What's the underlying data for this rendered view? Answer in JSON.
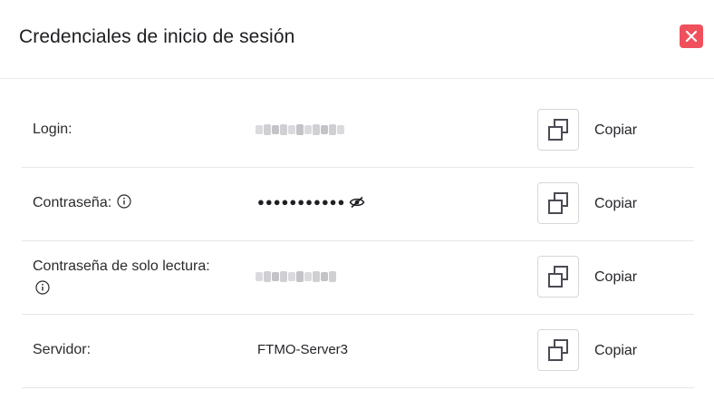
{
  "dialog": {
    "title": "Credenciales de inicio de sesión",
    "close_icon": "close-x-icon",
    "close_color": "#f0505c"
  },
  "rows": [
    {
      "label": "Login:",
      "value": "",
      "value_obscured": true,
      "copy_label": "Copiar",
      "copy_icon": "copy-icon"
    },
    {
      "label": "Contraseña:",
      "has_info": true,
      "value": "●●●●●●●●●●●",
      "toggle_icon": "eye-off-icon",
      "copy_label": "Copiar",
      "copy_icon": "copy-icon"
    },
    {
      "label": "Contraseña de solo lectura:",
      "has_info": true,
      "value": "",
      "value_obscured": true,
      "copy_label": "Copiar",
      "copy_icon": "copy-icon"
    },
    {
      "label": "Servidor:",
      "value": "FTMO-Server3",
      "copy_label": "Copiar",
      "copy_icon": "copy-icon"
    }
  ]
}
